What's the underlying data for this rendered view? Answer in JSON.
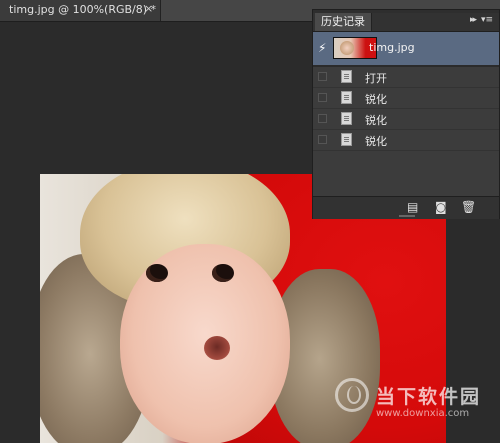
{
  "document": {
    "tab_title": "timg.jpg @ 100%(RGB/8) *",
    "close_glyph": "×"
  },
  "history_panel": {
    "tab_label": "历史记录",
    "collapse_glyph": "▸▸",
    "menu_glyph": "▾≡",
    "snapshot": {
      "label": "timg.jpg",
      "brush_glyph": "⚡"
    },
    "states": [
      {
        "label": "打开"
      },
      {
        "label": "锐化"
      },
      {
        "label": "锐化"
      },
      {
        "label": "锐化"
      }
    ],
    "footer": {
      "new_document_icon": "▤",
      "snapshot_icon": "◙",
      "delete_icon": "🗑"
    }
  },
  "watermark": {
    "text": "当下软件园",
    "url": "www.downxia.com"
  },
  "colors": {
    "panel_bg": "#3c3c3c",
    "selected_row": "#5a6a82",
    "canvas_bg": "#2b2b2b"
  }
}
